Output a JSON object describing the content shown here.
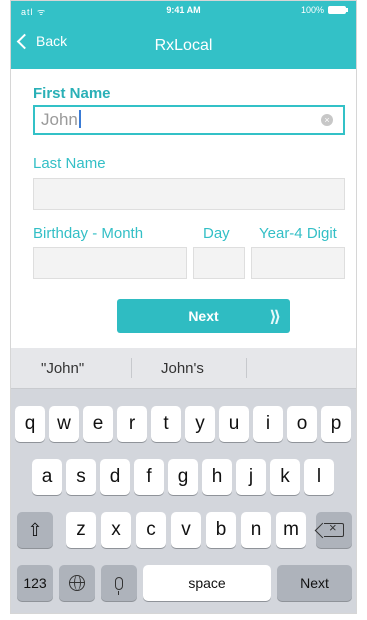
{
  "status": {
    "signal": "atl ᯤ",
    "time": "9:41 AM",
    "battery": "100%"
  },
  "nav": {
    "back_label": "Back",
    "title": "RxLocal"
  },
  "form": {
    "first_name_label": "First Name",
    "first_name_value": "John",
    "last_name_label": "Last Name",
    "last_name_value": "",
    "birth_month_label": "Birthday - Month",
    "birth_day_label": "Day",
    "birth_year_label": "Year-4 Digit",
    "next_label": "Next",
    "next_chevrons": "⟩⟩"
  },
  "keyboard": {
    "suggestions": [
      "\"John\"",
      "John's",
      ""
    ],
    "row1": [
      "q",
      "w",
      "e",
      "r",
      "t",
      "y",
      "u",
      "i",
      "o",
      "p"
    ],
    "row2": [
      "a",
      "s",
      "d",
      "f",
      "g",
      "h",
      "j",
      "k",
      "l"
    ],
    "row3": [
      "z",
      "x",
      "c",
      "v",
      "b",
      "n",
      "m"
    ],
    "numbers_key": "123",
    "space_key": "space",
    "return_key": "Next"
  },
  "colors": {
    "accent": "#33c1c7",
    "keyboard_bg": "#d3d6dc"
  }
}
